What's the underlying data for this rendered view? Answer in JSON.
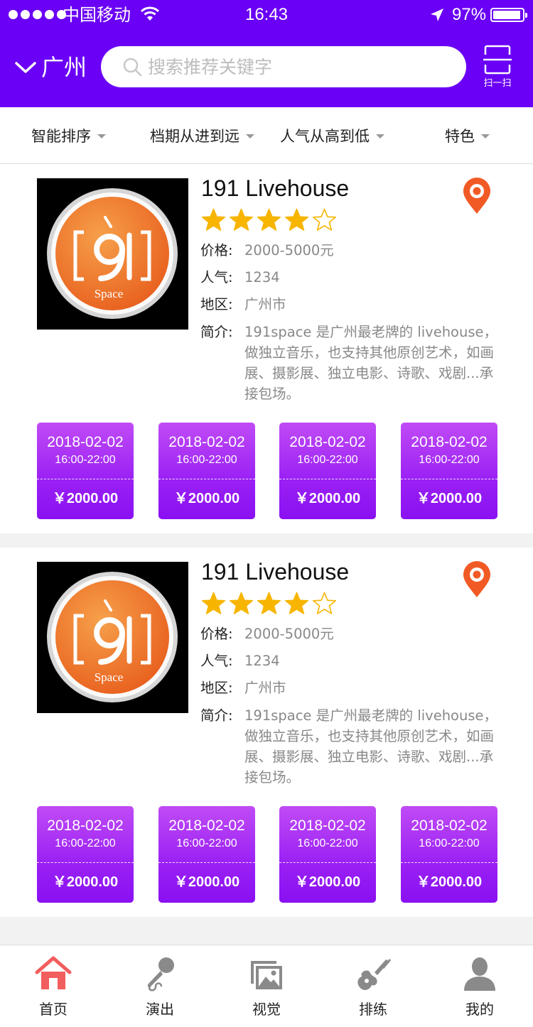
{
  "status_bar": {
    "carrier": "中国移动",
    "time": "16:43",
    "battery": "97%",
    "battery_level": 0.97
  },
  "header": {
    "city": "广州",
    "search_placeholder": "搜索推荐关键字",
    "scan_label": "扫一扫",
    "background_color": "#6a00f5"
  },
  "filters": [
    {
      "label": "智能排序"
    },
    {
      "label": "档期从进到远"
    },
    {
      "label": "人气从高到低"
    },
    {
      "label": "特色"
    }
  ],
  "venues": [
    {
      "name": "191 Livehouse",
      "rating": 4,
      "rating_max": 5,
      "logo_text": "Space",
      "price_label": "价格:",
      "price": "2000-5000元",
      "popularity_label": "人气:",
      "popularity": "1234",
      "area_label": "地区:",
      "area": "广州市",
      "intro_label": "简介:",
      "intro": "191space 是广州最老牌的 livehouse，做独立音乐，也支持其他原创艺术，如画展、摄影展、独立电影、诗歌、戏剧...承接包场。",
      "slots": [
        {
          "date": "2018-02-02",
          "hours": "16:00-22:00",
          "price": "￥2000.00"
        },
        {
          "date": "2018-02-02",
          "hours": "16:00-22:00",
          "price": "￥2000.00"
        },
        {
          "date": "2018-02-02",
          "hours": "16:00-22:00",
          "price": "￥2000.00"
        },
        {
          "date": "2018-02-02",
          "hours": "16:00-22:00",
          "price": "￥2000.00"
        }
      ]
    },
    {
      "name": "191 Livehouse",
      "rating": 4,
      "rating_max": 5,
      "logo_text": "Space",
      "price_label": "价格:",
      "price": "2000-5000元",
      "popularity_label": "人气:",
      "popularity": "1234",
      "area_label": "地区:",
      "area": "广州市",
      "intro_label": "简介:",
      "intro": "191space 是广州最老牌的 livehouse，做独立音乐，也支持其他原创艺术，如画展、摄影展、独立电影、诗歌、戏剧...承接包场。",
      "slots": [
        {
          "date": "2018-02-02",
          "hours": "16:00-22:00",
          "price": "￥2000.00"
        },
        {
          "date": "2018-02-02",
          "hours": "16:00-22:00",
          "price": "￥2000.00"
        },
        {
          "date": "2018-02-02",
          "hours": "16:00-22:00",
          "price": "￥2000.00"
        },
        {
          "date": "2018-02-02",
          "hours": "16:00-22:00",
          "price": "￥2000.00"
        }
      ]
    }
  ],
  "tabbar": [
    {
      "label": "首页",
      "icon": "home-icon",
      "active": true
    },
    {
      "label": "演出",
      "icon": "microphone-icon",
      "active": false
    },
    {
      "label": "视觉",
      "icon": "image-icon",
      "active": false
    },
    {
      "label": "排练",
      "icon": "guitar-icon",
      "active": false
    },
    {
      "label": "我的",
      "icon": "user-icon",
      "active": false
    }
  ],
  "colors": {
    "accent": "#6a00f5",
    "slot_gradient_top": "#c04bf5",
    "slot_gradient_bottom": "#8a10f2",
    "star": "#f7b500",
    "pin": "#f15a24",
    "tab_active": "#f25d5d",
    "tab_inactive": "#8a8a8a"
  }
}
